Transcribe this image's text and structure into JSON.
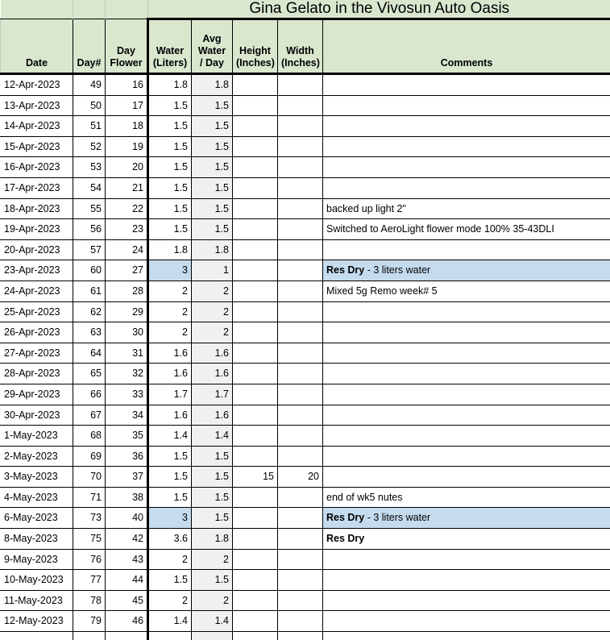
{
  "title": "Gina Gelato in the Vivosun Auto Oasis",
  "colors": {
    "header_green": "#d9e7ce",
    "highlight_blue": "#c5dcef",
    "avg_column_gray": "#f0f0f0",
    "grid_black": "#000000"
  },
  "columns": [
    {
      "key": "date",
      "label": "Date"
    },
    {
      "key": "day",
      "label": "Day#"
    },
    {
      "key": "dayflower",
      "label": "Day Flower"
    },
    {
      "key": "water",
      "label": "Water (Liters)"
    },
    {
      "key": "avgwater",
      "label": "Avg Water / Day"
    },
    {
      "key": "height",
      "label": "Height (Inches)"
    },
    {
      "key": "width",
      "label": "Width (Inches)"
    },
    {
      "key": "comments",
      "label": "Comments"
    }
  ],
  "header_lines": {
    "date": [
      "Date"
    ],
    "day": [
      "Day#"
    ],
    "dayflower": [
      "Day",
      "Flower"
    ],
    "water": [
      "Water",
      "(Liters)"
    ],
    "avgwater": [
      "Avg",
      "Water",
      "/ Day"
    ],
    "height": [
      "Height",
      "(Inches)"
    ],
    "width": [
      "Width",
      "(Inches)"
    ],
    "comments": [
      "Comments"
    ]
  },
  "rows": [
    {
      "date": "12-Apr-2023",
      "day": "49",
      "dayflower": "16",
      "water": "1.8",
      "avgwater": "1.8",
      "height": "",
      "width": "",
      "comments": "",
      "comments_bold": "",
      "highlight": false
    },
    {
      "date": "13-Apr-2023",
      "day": "50",
      "dayflower": "17",
      "water": "1.5",
      "avgwater": "1.5",
      "height": "",
      "width": "",
      "comments": "",
      "comments_bold": "",
      "highlight": false
    },
    {
      "date": "14-Apr-2023",
      "day": "51",
      "dayflower": "18",
      "water": "1.5",
      "avgwater": "1.5",
      "height": "",
      "width": "",
      "comments": "",
      "comments_bold": "",
      "highlight": false
    },
    {
      "date": "15-Apr-2023",
      "day": "52",
      "dayflower": "19",
      "water": "1.5",
      "avgwater": "1.5",
      "height": "",
      "width": "",
      "comments": "",
      "comments_bold": "",
      "highlight": false
    },
    {
      "date": "16-Apr-2023",
      "day": "53",
      "dayflower": "20",
      "water": "1.5",
      "avgwater": "1.5",
      "height": "",
      "width": "",
      "comments": "",
      "comments_bold": "",
      "highlight": false
    },
    {
      "date": "17-Apr-2023",
      "day": "54",
      "dayflower": "21",
      "water": "1.5",
      "avgwater": "1.5",
      "height": "",
      "width": "",
      "comments": "",
      "comments_bold": "",
      "highlight": false
    },
    {
      "date": "18-Apr-2023",
      "day": "55",
      "dayflower": "22",
      "water": "1.5",
      "avgwater": "1.5",
      "height": "",
      "width": "",
      "comments": "backed up light 2\"",
      "comments_bold": "",
      "highlight": false
    },
    {
      "date": "19-Apr-2023",
      "day": "56",
      "dayflower": "23",
      "water": "1.5",
      "avgwater": "1.5",
      "height": "",
      "width": "",
      "comments": "Switched to AeroLight flower mode 100% 35-43DLI",
      "comments_bold": "",
      "highlight": false
    },
    {
      "date": "20-Apr-2023",
      "day": "57",
      "dayflower": "24",
      "water": "1.8",
      "avgwater": "1.8",
      "height": "",
      "width": "",
      "comments": "",
      "comments_bold": "",
      "highlight": false
    },
    {
      "date": "23-Apr-2023",
      "day": "60",
      "dayflower": "27",
      "water": "3",
      "avgwater": "1",
      "height": "",
      "width": "",
      "comments": " - 3 liters water",
      "comments_bold": "Res Dry",
      "highlight": true
    },
    {
      "date": "24-Apr-2023",
      "day": "61",
      "dayflower": "28",
      "water": "2",
      "avgwater": "2",
      "height": "",
      "width": "",
      "comments": "Mixed 5g Remo week# 5",
      "comments_bold": "",
      "highlight": false
    },
    {
      "date": "25-Apr-2023",
      "day": "62",
      "dayflower": "29",
      "water": "2",
      "avgwater": "2",
      "height": "",
      "width": "",
      "comments": "",
      "comments_bold": "",
      "highlight": false
    },
    {
      "date": "26-Apr-2023",
      "day": "63",
      "dayflower": "30",
      "water": "2",
      "avgwater": "2",
      "height": "",
      "width": "",
      "comments": "",
      "comments_bold": "",
      "highlight": false
    },
    {
      "date": "27-Apr-2023",
      "day": "64",
      "dayflower": "31",
      "water": "1.6",
      "avgwater": "1.6",
      "height": "",
      "width": "",
      "comments": "",
      "comments_bold": "",
      "highlight": false
    },
    {
      "date": "28-Apr-2023",
      "day": "65",
      "dayflower": "32",
      "water": "1.6",
      "avgwater": "1.6",
      "height": "",
      "width": "",
      "comments": "",
      "comments_bold": "",
      "highlight": false
    },
    {
      "date": "29-Apr-2023",
      "day": "66",
      "dayflower": "33",
      "water": "1.7",
      "avgwater": "1.7",
      "height": "",
      "width": "",
      "comments": "",
      "comments_bold": "",
      "highlight": false
    },
    {
      "date": "30-Apr-2023",
      "day": "67",
      "dayflower": "34",
      "water": "1.6",
      "avgwater": "1.6",
      "height": "",
      "width": "",
      "comments": "",
      "comments_bold": "",
      "highlight": false
    },
    {
      "date": "1-May-2023",
      "day": "68",
      "dayflower": "35",
      "water": "1.4",
      "avgwater": "1.4",
      "height": "",
      "width": "",
      "comments": "",
      "comments_bold": "",
      "highlight": false
    },
    {
      "date": "2-May-2023",
      "day": "69",
      "dayflower": "36",
      "water": "1.5",
      "avgwater": "1.5",
      "height": "",
      "width": "",
      "comments": "",
      "comments_bold": "",
      "highlight": false
    },
    {
      "date": "3-May-2023",
      "day": "70",
      "dayflower": "37",
      "water": "1.5",
      "avgwater": "1.5",
      "height": "15",
      "width": "20",
      "comments": "",
      "comments_bold": "",
      "highlight": false
    },
    {
      "date": "4-May-2023",
      "day": "71",
      "dayflower": "38",
      "water": "1.5",
      "avgwater": "1.5",
      "height": "",
      "width": "",
      "comments": "end of wk5 nutes",
      "comments_bold": "",
      "highlight": false
    },
    {
      "date": "6-May-2023",
      "day": "73",
      "dayflower": "40",
      "water": "3",
      "avgwater": "1.5",
      "height": "",
      "width": "",
      "comments": " - 3 liters water",
      "comments_bold": "Res Dry",
      "highlight": true
    },
    {
      "date": "8-May-2023",
      "day": "75",
      "dayflower": "42",
      "water": "3.6",
      "avgwater": "1.8",
      "height": "",
      "width": "",
      "comments": "",
      "comments_bold": "Res Dry",
      "highlight": false
    },
    {
      "date": "9-May-2023",
      "day": "76",
      "dayflower": "43",
      "water": "2",
      "avgwater": "2",
      "height": "",
      "width": "",
      "comments": "",
      "comments_bold": "",
      "highlight": false
    },
    {
      "date": "10-May-2023",
      "day": "77",
      "dayflower": "44",
      "water": "1.5",
      "avgwater": "1.5",
      "height": "",
      "width": "",
      "comments": "",
      "comments_bold": "",
      "highlight": false
    },
    {
      "date": "11-May-2023",
      "day": "78",
      "dayflower": "45",
      "water": "2",
      "avgwater": "2",
      "height": "",
      "width": "",
      "comments": "",
      "comments_bold": "",
      "highlight": false
    },
    {
      "date": "12-May-2023",
      "day": "79",
      "dayflower": "46",
      "water": "1.4",
      "avgwater": "1.4",
      "height": "",
      "width": "",
      "comments": "",
      "comments_bold": "",
      "highlight": false
    }
  ]
}
